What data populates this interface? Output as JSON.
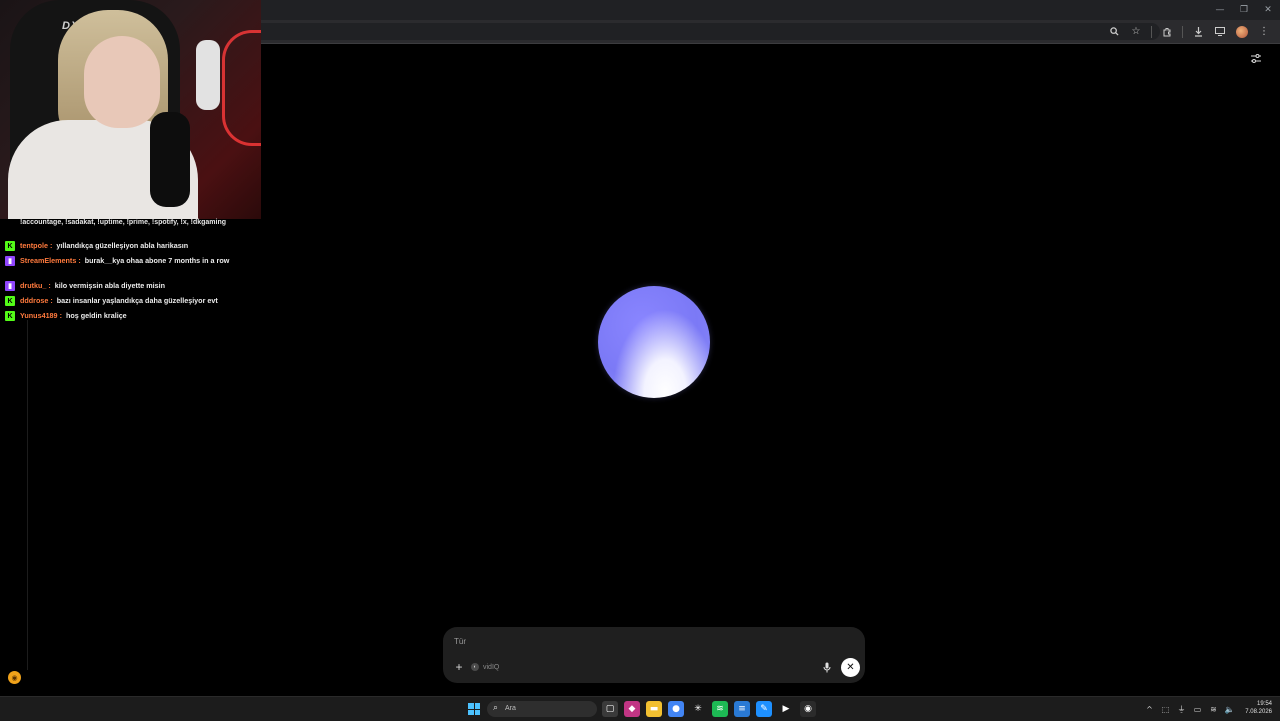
{
  "browser": {
    "window_controls": [
      "—",
      "❐",
      "✕"
    ],
    "toolbar_icons": [
      "zoom-icon",
      "bookmark-star-icon",
      "extensions-icon",
      "download-icon",
      "cast-icon",
      "profile-avatar",
      "menu-icon"
    ]
  },
  "chat": {
    "continuation": "!accountage, !sadakat, !uptime, !prime, !spotify, !x, !dkgaming",
    "messages": [
      {
        "badge": "kick",
        "user": "tentpole",
        "text": "yıllandıkça güzelleşiyon abla harikasın",
        "user_color": "#ff7a3d"
      },
      {
        "badge": "twitch",
        "user": "StreamElements",
        "text": "burak__kya ohaa abone 7 months in a row",
        "user_color": "#ff7a3d"
      },
      {
        "badge": "twitch",
        "user": "drutku_",
        "text": "kilo vermişsin abla diyette misin",
        "user_color": "#ff7a3d"
      },
      {
        "badge": "kick",
        "user": "dddrose",
        "text": "bazı insanlar yaşlandıkça daha güzelleşiyor evt",
        "user_color": "#ff7a3d"
      },
      {
        "badge": "kick",
        "user": "Yunus4189",
        "text": "hoş geldin kraliçe",
        "user_color": "#ff7a3d"
      }
    ]
  },
  "composer": {
    "placeholder": "Tür",
    "tool_label": "vidIQ"
  },
  "taskbar": {
    "search_label": "Ara",
    "time": "19:54",
    "date": "7.08.2026",
    "apps": [
      {
        "name": "task-view-icon",
        "color": "#3a3a3a",
        "glyph": "▢"
      },
      {
        "name": "store-icon",
        "color": "#c13584",
        "glyph": "◆"
      },
      {
        "name": "file-explorer-icon",
        "color": "#f2c031",
        "glyph": "▬"
      },
      {
        "name": "chrome-icon",
        "color": "#4285f4",
        "glyph": "●"
      },
      {
        "name": "snowflake-app-icon",
        "color": "#1c1c1c",
        "glyph": "✳"
      },
      {
        "name": "spotify-icon",
        "color": "#1db954",
        "glyph": "≋"
      },
      {
        "name": "notepad-icon",
        "color": "#2a7ad5",
        "glyph": "≡"
      },
      {
        "name": "paint-icon",
        "color": "#1e90ff",
        "glyph": "✎"
      },
      {
        "name": "play-app-icon",
        "color": "#1c1c1c",
        "glyph": "▶"
      },
      {
        "name": "obs-icon",
        "color": "#2b2b2b",
        "glyph": "◉"
      }
    ],
    "tray": [
      "^",
      "⬚",
      "⏚",
      "▭",
      "≋",
      "🔈"
    ]
  },
  "colors": {
    "orb": "#7b79f6",
    "kick_badge": "#53fc18",
    "twitch_badge": "#9146ff"
  }
}
